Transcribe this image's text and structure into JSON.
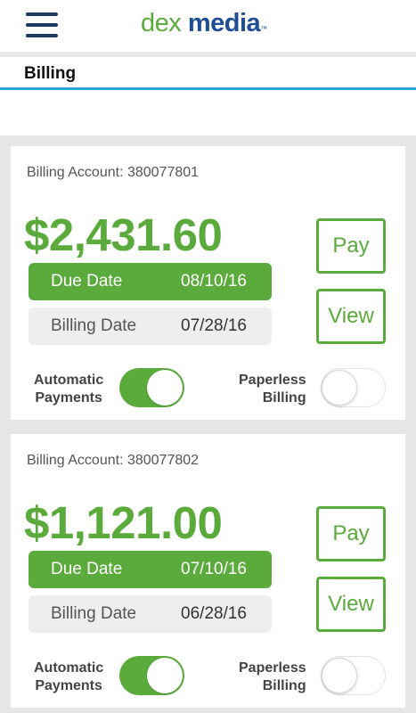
{
  "header": {
    "menu_icon": "hamburger-menu-icon",
    "logo_word1": "dex",
    "logo_word2": "media",
    "logo_tm": "™"
  },
  "page": {
    "title": "Billing"
  },
  "colors": {
    "brand_green": "#5aaa3c",
    "brand_blue": "#1f4e96",
    "accent_line": "#23a7d6"
  },
  "accounts": [
    {
      "account_label": "Billing Account: 380077801",
      "amount": "$2,431.60",
      "due_label": "Due Date",
      "due_date": "08/10/16",
      "billing_label": "Billing Date",
      "billing_date": "07/28/16",
      "pay_label": "Pay",
      "view_label": "View",
      "auto_label_line1": "Automatic",
      "auto_label_line2": "Payments",
      "auto_on": true,
      "paperless_label_line1": "Paperless",
      "paperless_label_line2": "Billing",
      "paperless_on": false
    },
    {
      "account_label": "Billing Account: 380077802",
      "amount": "$1,121.00",
      "due_label": "Due Date",
      "due_date": "07/10/16",
      "billing_label": "Billing Date",
      "billing_date": "06/28/16",
      "pay_label": "Pay",
      "view_label": "View",
      "auto_label_line1": "Automatic",
      "auto_label_line2": "Payments",
      "auto_on": true,
      "paperless_label_line1": "Paperless",
      "paperless_label_line2": "Billing",
      "paperless_on": false
    }
  ]
}
